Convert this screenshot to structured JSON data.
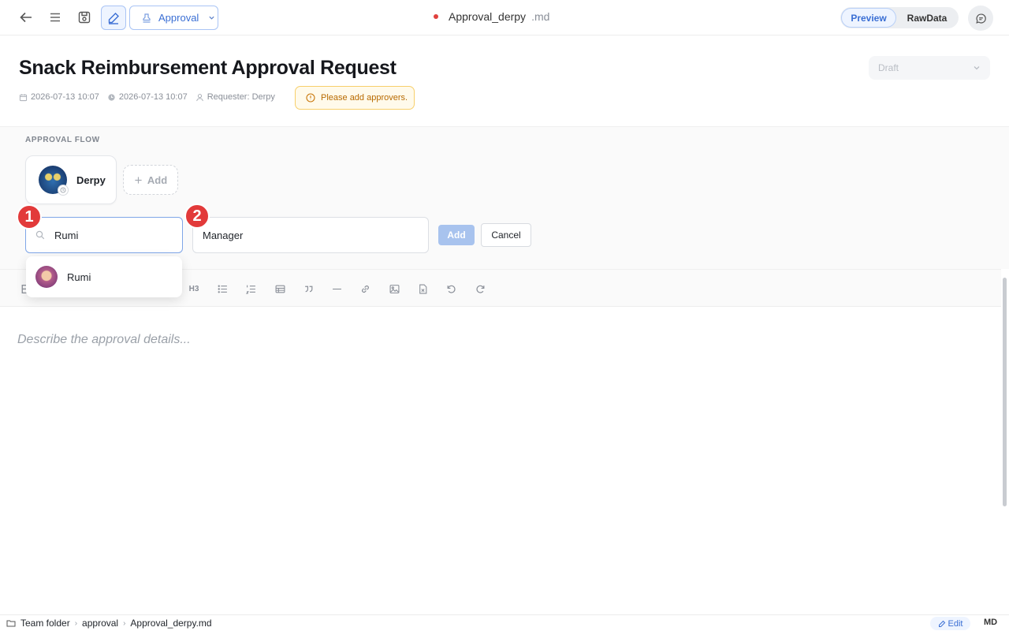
{
  "topbar": {
    "type_select": "Approval",
    "doc_name": "Approval_derpy",
    "doc_ext": ".md",
    "view_toggle": {
      "preview": "Preview",
      "rawdata": "RawData",
      "active": "Preview"
    },
    "icons": [
      "back-arrow-icon",
      "menu-icon",
      "save-icon",
      "edit-pencil-icon",
      "stamp-icon",
      "chevron-down-icon",
      "chat-icon"
    ]
  },
  "header": {
    "title": "Snack Reimbursement Approval Request",
    "status": "Draft",
    "created": "2026-07-13 10:07",
    "updated": "2026-07-13 10:07",
    "requester": "Requester: Derpy",
    "warning": "Please add approvers."
  },
  "flow": {
    "label": "APPROVAL FLOW",
    "approvers": [
      {
        "name": "Derpy"
      }
    ],
    "add_label": "Add",
    "search_value": "Rumi",
    "role_value": "Manager",
    "add_button": "Add",
    "cancel_button": "Cancel",
    "badges": [
      "1",
      "2"
    ]
  },
  "dropdown": {
    "options": [
      {
        "name": "Rumi"
      }
    ]
  },
  "toolbar": {
    "h3_label": "H3",
    "tools": [
      "bold-icon",
      "h3-icon",
      "bullet-list-icon",
      "numbered-list-icon",
      "table-icon",
      "quote-icon",
      "divider-icon",
      "link-icon",
      "image-icon",
      "file-icon",
      "undo-icon",
      "redo-icon"
    ]
  },
  "editor": {
    "placeholder": "Describe the approval details..."
  },
  "statusbar": {
    "breadcrumb": [
      "Team folder",
      "approval",
      "Approval_derpy.md"
    ],
    "mode": "Edit",
    "format": "MD"
  },
  "colors": {
    "accent": "#3b6fd4",
    "warning": "#b86a00",
    "unsaved_dot": "#e0413d",
    "badge_red": "#e23a3a"
  }
}
